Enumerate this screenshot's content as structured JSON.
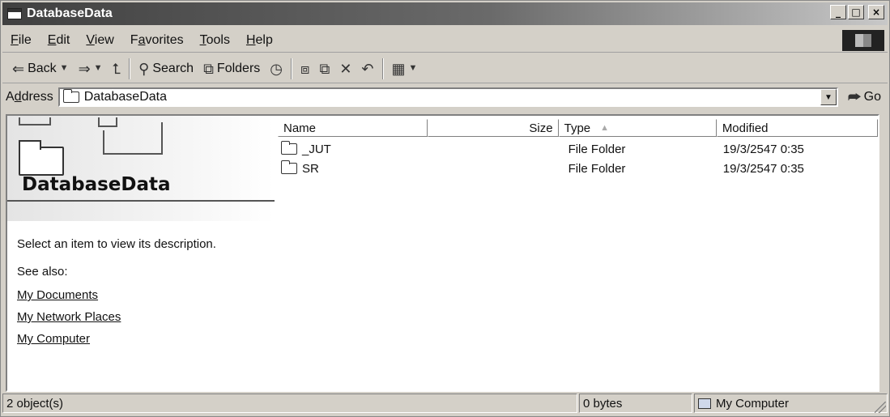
{
  "window": {
    "title": "DatabaseData"
  },
  "menu": {
    "items": [
      {
        "label": "File",
        "u": "F",
        "rest": "ile"
      },
      {
        "label": "Edit",
        "u": "E",
        "rest": "dit"
      },
      {
        "label": "View",
        "u": "V",
        "rest": "iew"
      },
      {
        "label": "Favorites",
        "pre": "F",
        "u": "a",
        "rest": "vorites"
      },
      {
        "label": "Tools",
        "u": "T",
        "rest": "ools"
      },
      {
        "label": "Help",
        "u": "H",
        "rest": "elp"
      }
    ]
  },
  "toolbar": {
    "back_label": "Back",
    "search_label": "Search",
    "folders_label": "Folders"
  },
  "address": {
    "label_pre": "A",
    "label_u": "d",
    "label_rest": "dress",
    "value": "DatabaseData",
    "go_label": "Go"
  },
  "left_pane": {
    "title": "DatabaseData",
    "description": "Select an item to view its description.",
    "see_also": "See also:",
    "links": [
      "My Documents",
      "My Network Places",
      "My Computer"
    ]
  },
  "list": {
    "columns": {
      "name": "Name",
      "size": "Size",
      "type": "Type",
      "modified": "Modified"
    },
    "rows": [
      {
        "name": "_JUT",
        "size": "",
        "type": "File Folder",
        "modified": "19/3/2547 0:35"
      },
      {
        "name": "SR",
        "size": "",
        "type": "File Folder",
        "modified": "19/3/2547 0:35"
      }
    ]
  },
  "status": {
    "objects": "2 object(s)",
    "size": "0 bytes",
    "zone": "My Computer"
  }
}
